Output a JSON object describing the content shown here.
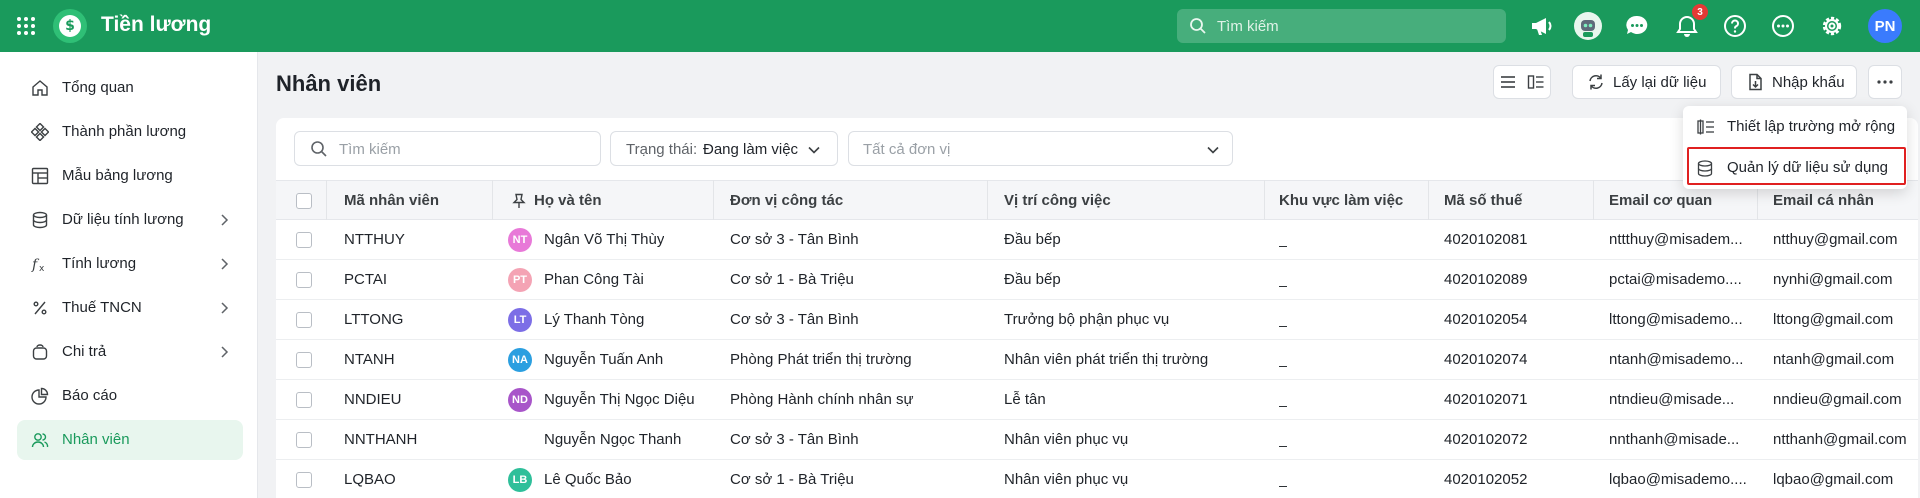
{
  "app": {
    "title": "Tiền lương",
    "brand_color": "#1a9a5c"
  },
  "topbar": {
    "search_placeholder": "Tìm kiếm",
    "notification_count": "3",
    "user_initials": "PN",
    "icons": [
      "apps-grid-icon",
      "megaphone-icon",
      "assistant-robot-icon",
      "chat-icon",
      "bell-icon",
      "help-icon",
      "more-dots-icon",
      "gear-icon"
    ]
  },
  "sidebar": {
    "items": [
      {
        "label": "Tổng quan",
        "icon": "home-icon",
        "has_children": false
      },
      {
        "label": "Thành phần lương",
        "icon": "components-icon",
        "has_children": false
      },
      {
        "label": "Mẫu bảng lương",
        "icon": "template-icon",
        "has_children": false
      },
      {
        "label": "Dữ liệu tính lương",
        "icon": "database-icon",
        "has_children": true
      },
      {
        "label": "Tính lương",
        "icon": "function-icon",
        "has_children": true
      },
      {
        "label": "Thuế TNCN",
        "icon": "percent-icon",
        "has_children": true
      },
      {
        "label": "Chi trả",
        "icon": "wallet-icon",
        "has_children": true
      },
      {
        "label": "Báo cáo",
        "icon": "pie-chart-icon",
        "has_children": false
      },
      {
        "label": "Nhân viên",
        "icon": "users-icon",
        "has_children": false,
        "active": true
      }
    ]
  },
  "page": {
    "title": "Nhân viên",
    "reload_label": "Lấy lại dữ liệu",
    "import_label": "Nhập khẩu"
  },
  "filters": {
    "search_placeholder": "Tìm kiếm",
    "status_label": "Trạng thái:",
    "status_value": "Đang làm việc",
    "unit_placeholder": "Tất cả đơn vị"
  },
  "table": {
    "columns": [
      "Mã nhân viên",
      "Họ và tên",
      "Đơn vị công tác",
      "Vị trí công việc",
      "Khu vực làm việc",
      "Mã số thuế",
      "Email cơ quan",
      "Email cá nhân"
    ],
    "rows": [
      {
        "code": "NTTHUY",
        "initials": "NT",
        "avatar_color": "#e879d8",
        "name": "Ngân Võ Thị Thùy",
        "unit": "Cơ sở 3 - Tân Bình",
        "position": "Đầu bếp",
        "area": "_",
        "tax": "4020102081",
        "work_email": "nttthuy@misadem...",
        "personal_email": "ntthuy@gmail.com"
      },
      {
        "code": "PCTAI",
        "initials": "PT",
        "avatar_color": "#f4a3b4",
        "name": "Phan Công Tài",
        "unit": "Cơ sở 1 - Bà Triệu",
        "position": "Đầu bếp",
        "area": "_",
        "tax": "4020102089",
        "work_email": "pctai@misademo....",
        "personal_email": "nynhi@gmail.com"
      },
      {
        "code": "LTTONG",
        "initials": "LT",
        "avatar_color": "#7c6ee6",
        "name": "Lý Thanh Tòng",
        "unit": "Cơ sở 3 - Tân Bình",
        "position": "Trưởng bộ phận phục vụ",
        "area": "_",
        "tax": "4020102054",
        "work_email": "lttong@misademo...",
        "personal_email": "lttong@gmail.com"
      },
      {
        "code": "NTANH",
        "initials": "NA",
        "avatar_color": "#2b9fe0",
        "name": "Nguyễn Tuấn Anh",
        "unit": "Phòng Phát triển thị trường",
        "position": "Nhân viên phát triển thị trường",
        "area": "_",
        "tax": "4020102074",
        "work_email": "ntanh@misademo...",
        "personal_email": "ntanh@gmail.com"
      },
      {
        "code": "NNDIEU",
        "initials": "ND",
        "avatar_color": "#a855c9",
        "name": "Nguyễn Thị Ngọc Diệu",
        "unit": "Phòng Hành chính nhân sự",
        "position": "Lễ tân",
        "area": "_",
        "tax": "4020102071",
        "work_email": "ntndieu@misade...",
        "personal_email": "nndieu@gmail.com"
      },
      {
        "code": "NNTHANH",
        "initials": "",
        "avatar_color": "",
        "name": "Nguyễn Ngọc Thanh",
        "unit": "Cơ sở 3 - Tân Bình",
        "position": "Nhân viên phục vụ",
        "area": "_",
        "tax": "4020102072",
        "work_email": "nnthanh@misade...",
        "personal_email": "ntthanh@gmail.com"
      },
      {
        "code": "LQBAO",
        "initials": "LB",
        "avatar_color": "#2fbf9a",
        "name": "Lê Quốc Bảo",
        "unit": "Cơ sở 1 - Bà Triệu",
        "position": "Nhân viên phục vụ",
        "area": "_",
        "tax": "4020102052",
        "work_email": "lqbao@misademo....",
        "personal_email": "lqbao@gmail.com"
      }
    ]
  },
  "more_menu": {
    "items": [
      {
        "label": "Thiết lập trường mở rộng",
        "icon": "extend-fields-icon"
      },
      {
        "label": "Quản lý dữ liệu sử dụng",
        "icon": "database-icon",
        "highlighted": true
      }
    ],
    "highlight_color": "#e02020"
  }
}
